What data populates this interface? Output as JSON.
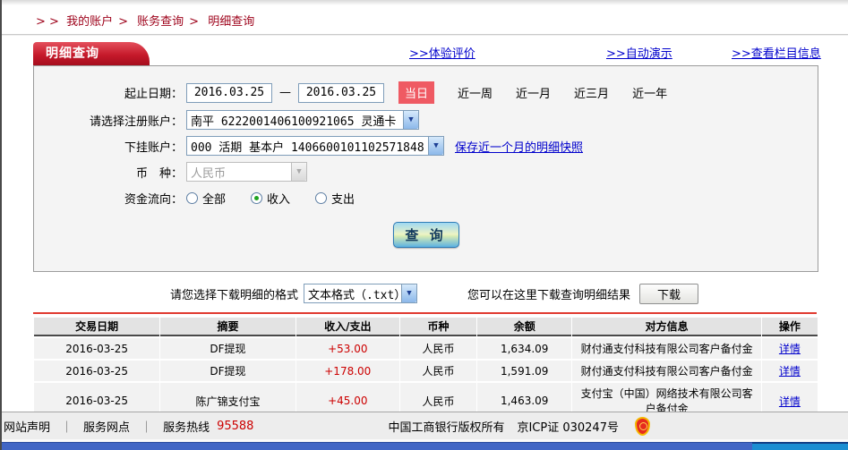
{
  "breadcrumb": {
    "prefix": "> >",
    "items": [
      "我的账户",
      "账务查询",
      "明细查询"
    ],
    "separator": ">"
  },
  "tab": {
    "label": "明细查询"
  },
  "top_links": {
    "0": ">>体验评价",
    "1": ">>自动演示",
    "2": ">>查看栏目信息"
  },
  "form": {
    "date_label": "起止日期：",
    "date_from": "2016.03.25",
    "date_dash": "—",
    "date_to": "2016.03.25",
    "quick_current": "当日",
    "quick_ranges": {
      "0": "近一周",
      "1": "近一月",
      "2": "近三月",
      "3": "近一年"
    },
    "account_label": "请选择注册账户：",
    "account_value": "南平 6222001406100921065 灵通卡",
    "sub_account_label": "下挂账户：",
    "sub_account_value": "000 活期 基本户 1406600101102571848",
    "snapshot_link": "保存近一个月的明细快照",
    "currency_label": "币　种：",
    "currency_value": "人民币",
    "flow_label": "资金流向：",
    "flow_options": [
      {
        "label": "全部",
        "selected": false
      },
      {
        "label": "收入",
        "selected": true
      },
      {
        "label": "支出",
        "selected": false
      }
    ],
    "query_button": "查 询"
  },
  "download": {
    "format_label": "请您选择下载明细的格式",
    "format_value": "文本格式（.txt）",
    "hint": "您可以在这里下载查询明细结果",
    "button": "下载"
  },
  "table": {
    "headers": {
      "0": "交易日期",
      "1": "摘要",
      "2": "收入/支出",
      "3": "币种",
      "4": "余额",
      "5": "对方信息",
      "6": "操作"
    },
    "rows": [
      {
        "date": "2016-03-25",
        "summary": "DF提现",
        "amount": "+53.00",
        "currency": "人民币",
        "balance": "1,634.09",
        "counterparty": "财付通支付科技有限公司客户备付金",
        "action": "详情"
      },
      {
        "date": "2016-03-25",
        "summary": "DF提现",
        "amount": "+178.00",
        "currency": "人民币",
        "balance": "1,591.09",
        "counterparty": "财付通支付科技有限公司客户备付金",
        "action": "详情"
      },
      {
        "date": "2016-03-25",
        "summary": "陈广锦支付宝",
        "amount": "+45.00",
        "currency": "人民币",
        "balance": "1,463.09",
        "counterparty": "支付宝（中国）网络技术有限公司客户备付金",
        "action": "详情"
      }
    ]
  },
  "footer": {
    "links": {
      "0": "网站声明",
      "1": "服务网点"
    },
    "hotline_label": "服务热线",
    "hotline_number": "95588",
    "copyright": "中国工商银行版权所有",
    "icp": "京ICP证 030247号",
    "badge_icon": "icp-emblem-icon"
  },
  "colors": {
    "brand_red": "#c61a2b",
    "breadcrumb_red": "#9d0019",
    "link_blue": "#0000cc",
    "amount_red": "#cc0000",
    "today_btn_red": "#ef5a63",
    "divider_red": "#e03a30",
    "footer_bar_blue": "#4166c5",
    "footer_bar_cyan": "#1b8ed2"
  }
}
